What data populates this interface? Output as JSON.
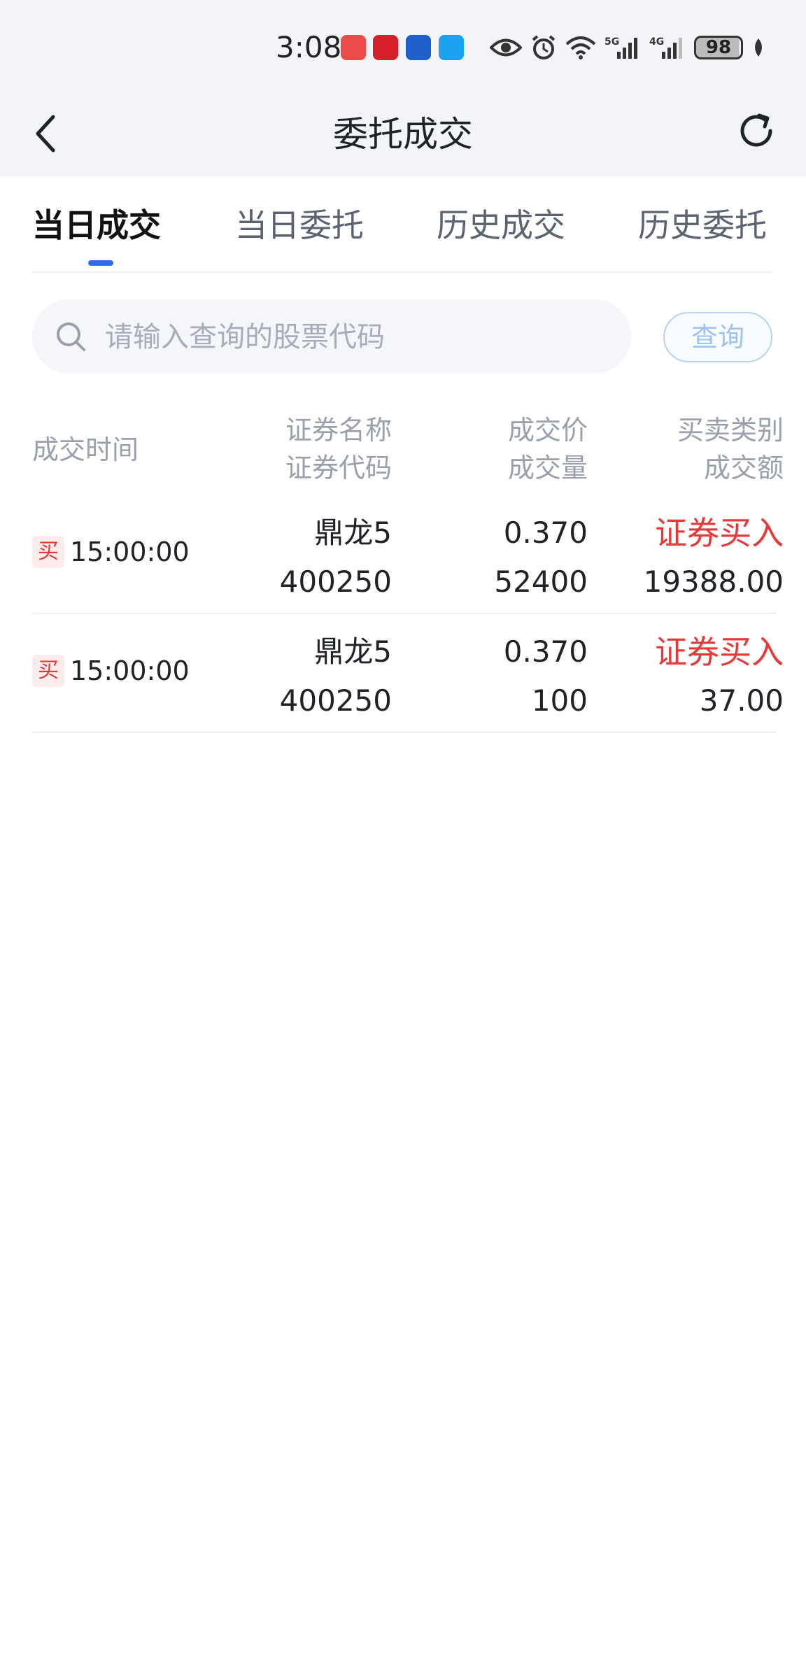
{
  "status_bar": {
    "time": "3:08",
    "battery": "98",
    "icons": [
      "app-notification-icon",
      "eye-icon",
      "alarm-icon",
      "wifi-icon",
      "5g-signal-icon",
      "4g-signal-icon",
      "battery-icon",
      "leaf-icon"
    ]
  },
  "header": {
    "title": "委托成交",
    "back_icon": "chevron-left-icon",
    "refresh_icon": "refresh-icon"
  },
  "tabs": [
    {
      "label": "当日成交",
      "active": true
    },
    {
      "label": "当日委托",
      "active": false
    },
    {
      "label": "历史成交",
      "active": false
    },
    {
      "label": "历史委托",
      "active": false
    }
  ],
  "search": {
    "placeholder": "请输入查询的股票代码",
    "value": "",
    "button_label": "查询"
  },
  "table": {
    "headers": {
      "time": "成交时间",
      "name": "证券名称",
      "code": "证券代码",
      "price": "成交价",
      "volume": "成交量",
      "type": "买卖类别",
      "amount": "成交额"
    },
    "rows": [
      {
        "badge": "买",
        "time": "15:00:00",
        "name": "鼎龙5",
        "code": "400250",
        "price": "0.370",
        "volume": "52400",
        "type": "证券买入",
        "amount": "19388.00"
      },
      {
        "badge": "买",
        "time": "15:00:00",
        "name": "鼎龙5",
        "code": "400250",
        "price": "0.370",
        "volume": "100",
        "type": "证券买入",
        "amount": "37.00"
      }
    ]
  },
  "colors": {
    "accent": "#2f6ee6",
    "buy_red": "#e5393a",
    "header_bg": "#f3f4f7"
  }
}
